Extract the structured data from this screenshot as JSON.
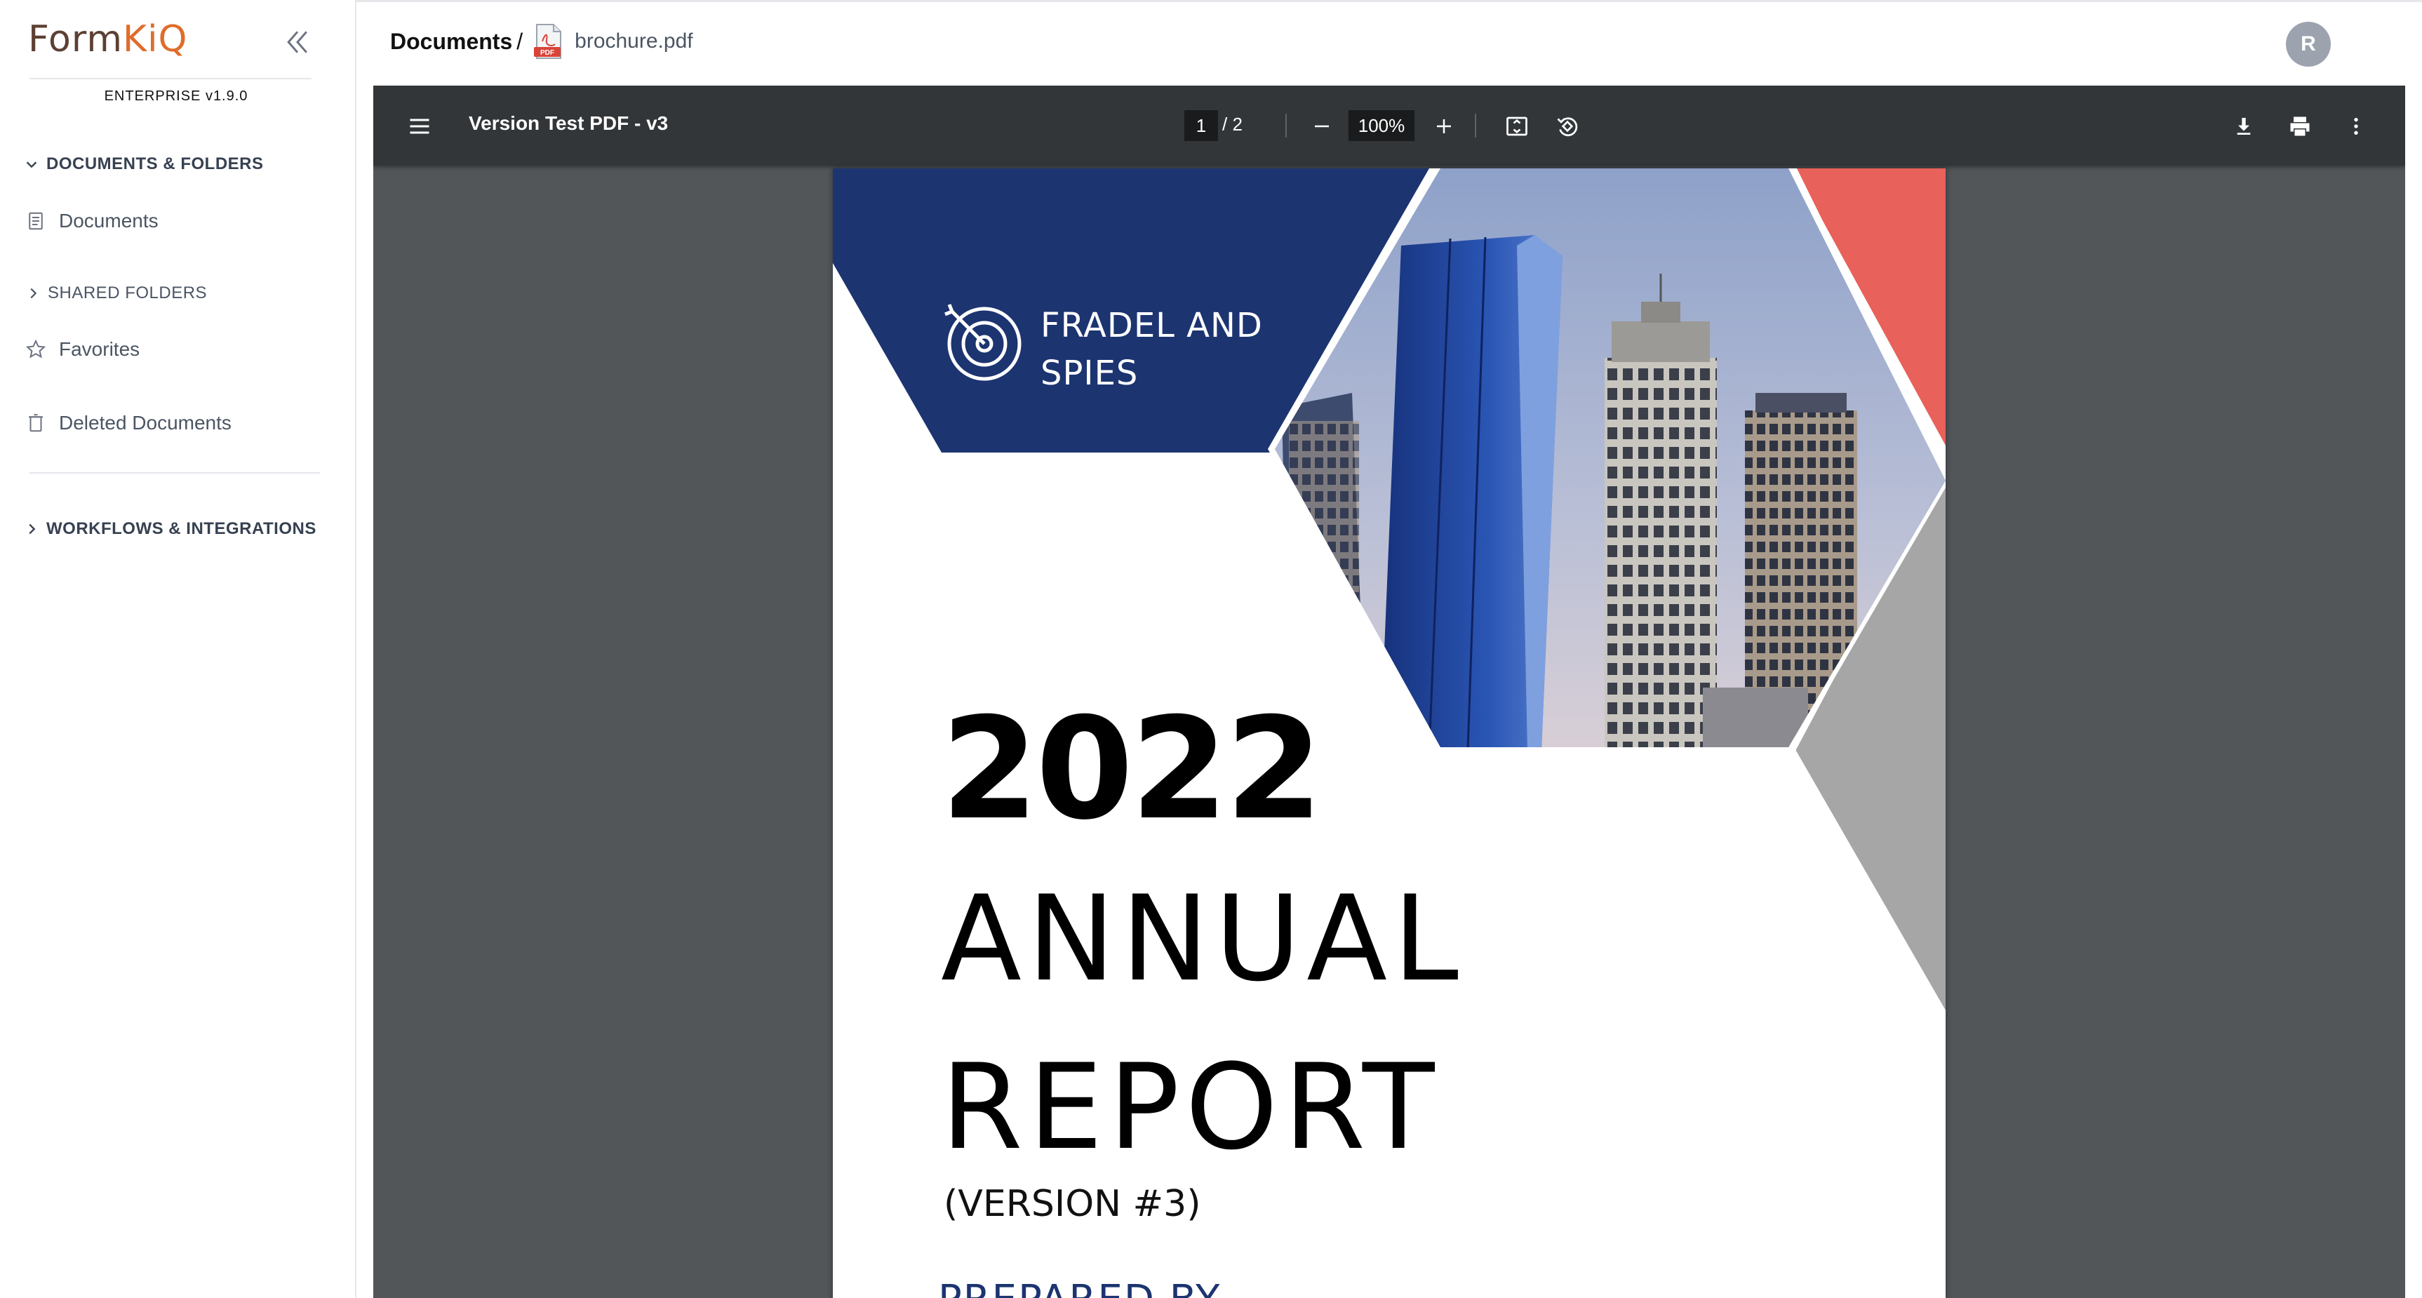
{
  "app": {
    "logo_part1": "Form",
    "logo_part2": "KiQ",
    "edition": "ENTERPRISE v1.9.0"
  },
  "sidebar": {
    "sections": [
      {
        "label": "DOCUMENTS & FOLDERS",
        "expanded": true
      },
      {
        "label": "SHARED FOLDERS",
        "expanded": false
      },
      {
        "label": "WORKFLOWS & INTEGRATIONS",
        "expanded": false
      }
    ],
    "items": [
      {
        "label": "Documents",
        "icon": "document-icon"
      },
      {
        "label": "Favorites",
        "icon": "star-icon"
      },
      {
        "label": "Deleted Documents",
        "icon": "trash-icon"
      }
    ]
  },
  "header": {
    "breadcrumb_root": "Documents",
    "breadcrumb_sep": "/",
    "file_name": "brochure.pdf",
    "file_icon": "pdf-file-icon",
    "avatar_initial": "R"
  },
  "viewer": {
    "title": "Version Test PDF - v3",
    "current_page": "1",
    "page_total": "/  2",
    "zoom": "100%",
    "icons": [
      "menu-icon",
      "zoom-out-icon",
      "zoom-in-icon",
      "fit-page-icon",
      "rotate-icon",
      "download-icon",
      "print-icon",
      "more-vertical-icon"
    ]
  },
  "document": {
    "company_line1": "FRADEL AND",
    "company_line2": "SPIES",
    "year": "2022",
    "word1": "ANNUAL",
    "word2": "REPORT",
    "version": "(VERSION #3)",
    "prepared_by": "PREPARED BY"
  },
  "colors": {
    "navy": "#1c3470",
    "coral": "#e8615a",
    "gray_shape": "#a6a6a6",
    "viewer_bg": "#525659",
    "toolbar_bg": "#323639",
    "brand_orange": "#e06c2a"
  }
}
